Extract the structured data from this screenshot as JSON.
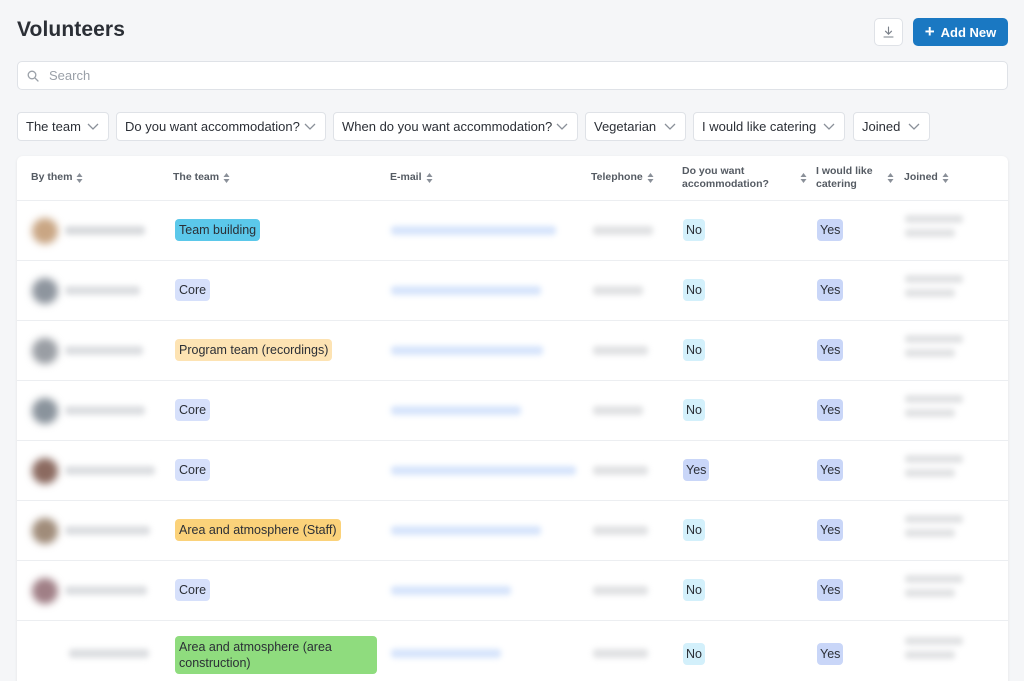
{
  "page": {
    "title": "Volunteers"
  },
  "toolbar": {
    "add_label": "Add New",
    "add_icon": "plus-icon",
    "download_icon": "download-icon"
  },
  "search": {
    "placeholder": "Search",
    "value": ""
  },
  "filters": [
    {
      "label": "The team"
    },
    {
      "label": "Do you want accommodation?"
    },
    {
      "label": "When do you want accommodation?"
    },
    {
      "label": "Vegetarian"
    },
    {
      "label": "I would like catering"
    },
    {
      "label": "Joined"
    }
  ],
  "table": {
    "columns": {
      "by_them": "By them",
      "team": "The team",
      "email": "E-mail",
      "telephone": "Telephone",
      "accommodation_line1": "Do you want",
      "accommodation_line2": "accommodation?",
      "catering_line1": "I would like",
      "catering_line2": "catering",
      "joined": "Joined"
    },
    "rows": [
      {
        "team": "Team building",
        "team_color": "#5bc8ea",
        "accommodation": "No",
        "catering": "Yes"
      },
      {
        "team": "Core",
        "team_color": "#d6e0fb",
        "accommodation": "No",
        "catering": "Yes"
      },
      {
        "team": "Program team (recordings)",
        "team_color": "#fde3b3",
        "accommodation": "No",
        "catering": "Yes"
      },
      {
        "team": "Core",
        "team_color": "#d6e0fb",
        "accommodation": "No",
        "catering": "Yes"
      },
      {
        "team": "Core",
        "team_color": "#d6e0fb",
        "accommodation": "Yes",
        "catering": "Yes"
      },
      {
        "team": "Area and atmosphere (Staff)",
        "team_color": "#fbd27a",
        "accommodation": "No",
        "catering": "Yes"
      },
      {
        "team": "Core",
        "team_color": "#d6e0fb",
        "accommodation": "No",
        "catering": "Yes"
      },
      {
        "team": "Area and atmosphere (area construction)",
        "team_color": "#8fdc7e",
        "accommodation": "No",
        "catering": "Yes"
      }
    ]
  },
  "colors": {
    "accent": "#1a78c2",
    "no_pill": "#d3f0fb",
    "yes_pill": "#d6e0fb",
    "yes_pill_alt": "#c9d6f8"
  }
}
